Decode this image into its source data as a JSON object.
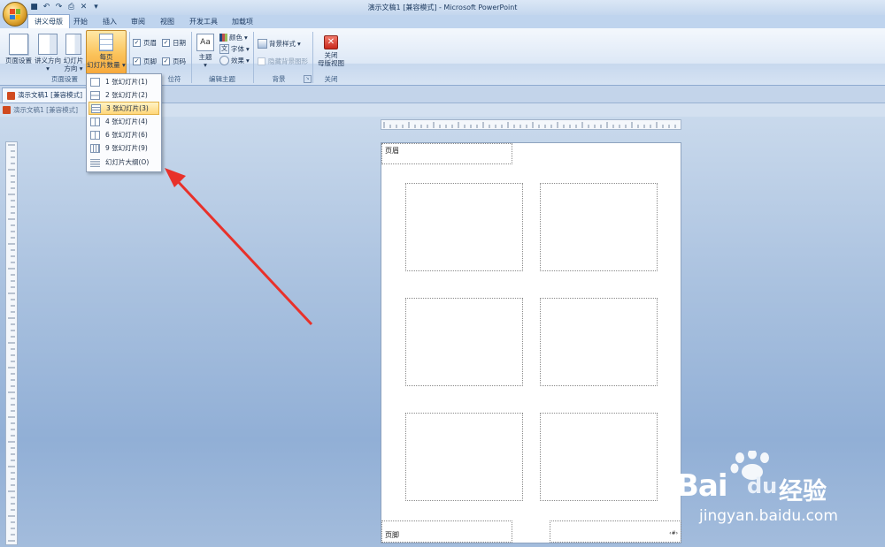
{
  "window": {
    "title": "演示文稿1 [兼容模式] - Microsoft PowerPoint"
  },
  "ribbon": {
    "tabs": [
      "讲义母版",
      "开始",
      "插入",
      "审阅",
      "视图",
      "开发工具",
      "加载项"
    ],
    "active_tab": "讲义母版",
    "groups": {
      "page_setup": {
        "label": "页面设置",
        "page_setup_button": "页面设置",
        "handout_orientation_l1": "讲义方向",
        "slide_orientation_l1": "幻灯片",
        "slide_orientation_l2": "方向",
        "per_page_l1": "每页",
        "per_page_l2": "幻灯片数量"
      },
      "placeholders": {
        "label_fragment": "位符",
        "header": "页眉",
        "date": "日期",
        "footer": "页脚",
        "page_number": "页码"
      },
      "edit_theme": {
        "label": "编辑主题",
        "theme": "主题",
        "colors": "颜色",
        "fonts": "字体",
        "effects": "效果"
      },
      "background": {
        "label": "背景",
        "styles": "背景样式",
        "hide_graphics": "隐藏背景图形"
      },
      "close": {
        "label": "关闭",
        "close_l1": "关闭",
        "close_l2": "母版视图"
      }
    }
  },
  "dropdown": {
    "items": [
      "1 张幻灯片(1)",
      "2 张幻灯片(2)",
      "3 张幻灯片(3)",
      "4 张幻灯片(4)",
      "6 张幻灯片(6)",
      "9 张幻灯片(9)",
      "幻灯片大纲(O)"
    ],
    "highlighted": "3 张幻灯片(3)"
  },
  "documents": {
    "tab1": "演示文稿1 [兼容模式]",
    "tab2": "演示文稿1 [兼容模式]"
  },
  "page": {
    "header": "页眉",
    "footer": "页脚",
    "page_number": "‹#›"
  },
  "watermark": {
    "brand": "Bai",
    "brand_cn": "经验",
    "url": "jingyan.baidu.com"
  },
  "colors": {
    "accent": "#f7a93c",
    "arrow": "#e8312a",
    "ribbon": "#dde8f6"
  }
}
